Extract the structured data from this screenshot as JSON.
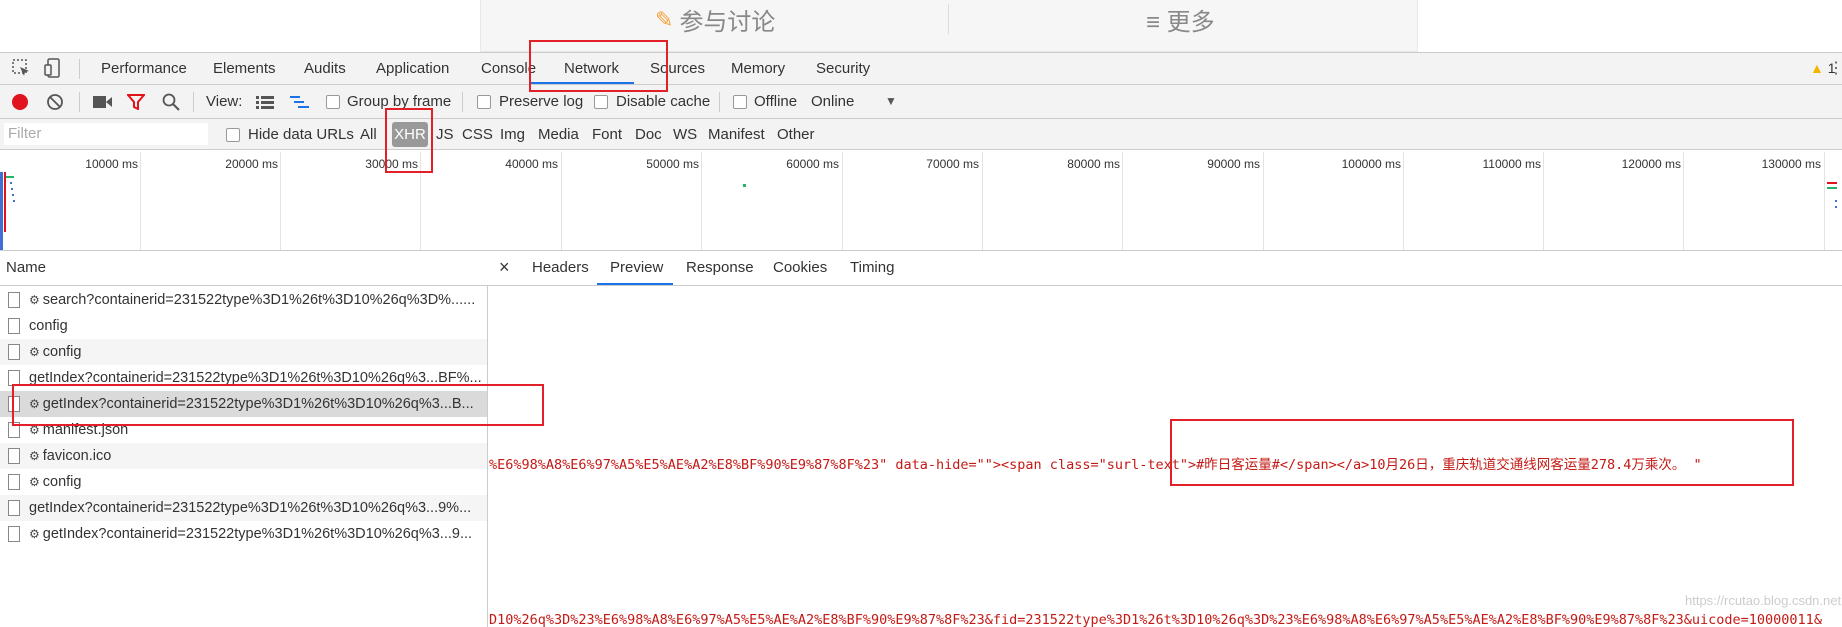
{
  "page_strip": {
    "discuss_label": "参与讨论",
    "more_label": "≡ 更多"
  },
  "devtools": {
    "tabs": [
      "Performance",
      "Elements",
      "Audits",
      "Application",
      "Console",
      "Network",
      "Sources",
      "Memory",
      "Security"
    ],
    "active_tab": "Network",
    "warning_count": "1"
  },
  "toolbar": {
    "view_label": "View:",
    "group_by_frame": "Group by frame",
    "preserve_log": "Preserve log",
    "disable_cache": "Disable cache",
    "offline": "Offline",
    "throttle": "Online"
  },
  "filter_bar": {
    "placeholder": "Filter",
    "hide_data_urls": "Hide data URLs",
    "types": [
      "All",
      "XHR",
      "JS",
      "CSS",
      "Img",
      "Media",
      "Font",
      "Doc",
      "WS",
      "Manifest",
      "Other"
    ],
    "active_type": "XHR"
  },
  "timeline": {
    "ticks": [
      "10000 ms",
      "20000 ms",
      "30000 ms",
      "40000 ms",
      "50000 ms",
      "60000 ms",
      "70000 ms",
      "80000 ms",
      "90000 ms",
      "100000 ms",
      "110000 ms",
      "120000 ms",
      "130000 ms"
    ]
  },
  "requests": {
    "header": "Name",
    "rows": [
      {
        "name": "search?containerid=231522type%3D1%26t%3D10%26q%3D%......",
        "gear": true
      },
      {
        "name": "config",
        "gear": false
      },
      {
        "name": "config",
        "gear": true
      },
      {
        "name": "getIndex?containerid=231522type%3D1%26t%3D10%26q%3...BF%...",
        "gear": false
      },
      {
        "name": "getIndex?containerid=231522type%3D1%26t%3D10%26q%3...B...",
        "gear": true
      },
      {
        "name": "manifest.json",
        "gear": true
      },
      {
        "name": "favicon.ico",
        "gear": true
      },
      {
        "name": "config",
        "gear": true
      },
      {
        "name": "getIndex?containerid=231522type%3D1%26t%3D10%26q%3...9%...",
        "gear": false
      },
      {
        "name": "getIndex?containerid=231522type%3D1%26t%3D10%26q%3...9...",
        "gear": true
      }
    ]
  },
  "detail": {
    "tabs": [
      "Headers",
      "Preview",
      "Response",
      "Cookies",
      "Timing"
    ],
    "active_tab": "Preview",
    "line1": "%E6%98%A8%E6%97%A5%E5%AE%A2%E8%BF%90%E9%87%8F%23\" data-hide=\"\"><span class=\"surl-text\">#昨日客运量#</span></a>10月26日，重庆轨道交通线网客运量278.4万乘次。 \"",
    "line2": "D10%26q%3D%23%E6%98%A8%E6%97%A5%E5%AE%A2%E8%BF%90%E9%87%8F%23&fid=231522type%3D1%26t%3D10%26q%3D%23%E6%98%A8%E6%97%A5%E5%AE%A2%E8%BF%90%E9%87%8F%23&uicode=10000011&"
  },
  "watermark": "https://rcutao.blog.csdn.net"
}
